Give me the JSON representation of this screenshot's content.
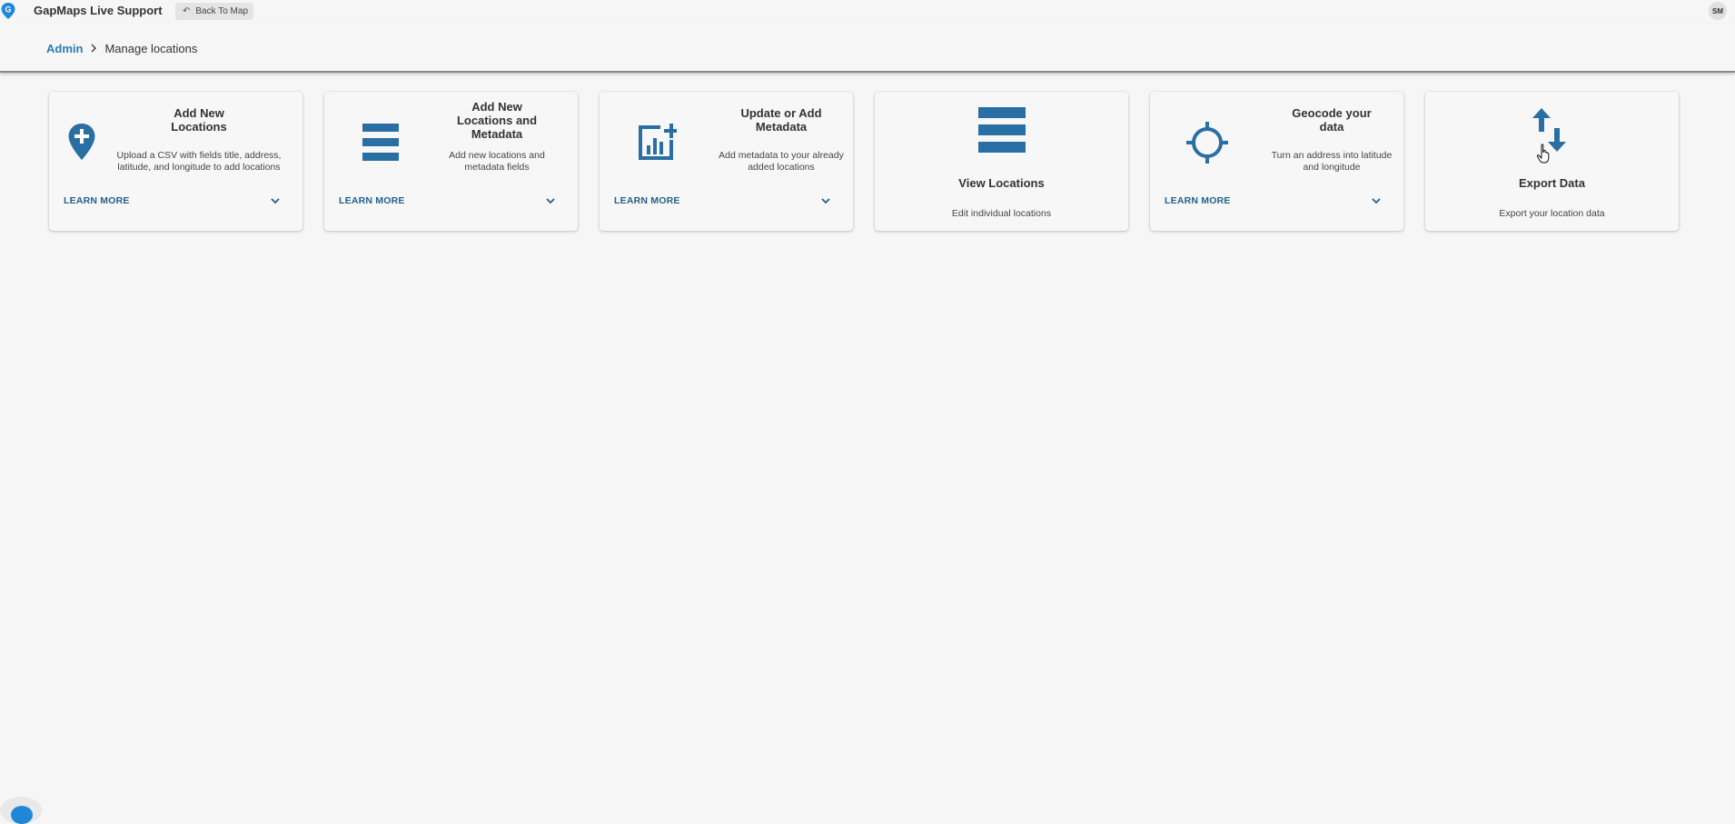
{
  "header": {
    "app_title": "GapMaps Live Support",
    "back_button_label": "Back To Map",
    "avatar_initials": "SM",
    "brand_color": "#1e88d6"
  },
  "breadcrumb": {
    "root": "Admin",
    "current": "Manage locations"
  },
  "accent_color": "#2a6fa3",
  "cards": [
    {
      "title": "Add New Locations",
      "title_lines": [
        "Add New",
        "Locations"
      ],
      "description_lines": [
        "Upload a CSV with fields title, address,",
        "latitude, and longitude to add locations"
      ],
      "icon": "location-plus-icon",
      "learn_more": "LEARN MORE"
    },
    {
      "title": "Add New Locations and Metadata",
      "title_lines": [
        "Add New",
        "Locations and",
        "Metadata"
      ],
      "description_lines": [
        "Add new locations and",
        "metadata fields"
      ],
      "icon": "list-bars-icon",
      "learn_more": "LEARN MORE"
    },
    {
      "title": "Update or Add Metadata",
      "title_lines": [
        "Update or Add",
        "Metadata"
      ],
      "description_lines": [
        "Add metadata to your already",
        "added locations"
      ],
      "icon": "chart-add-icon",
      "learn_more": "LEARN MORE"
    },
    {
      "title": "View Locations",
      "description": "Edit individual locations",
      "icon": "list-bars-icon"
    },
    {
      "title": "Geocode your data",
      "title_lines": [
        "Geocode your",
        "data"
      ],
      "description_lines": [
        "Turn an address into latitude",
        "and longitude"
      ],
      "icon": "crosshair-icon",
      "learn_more": "LEARN MORE"
    },
    {
      "title": "Export Data",
      "description": "Export your location data",
      "icon": "swap-vertical-icon"
    }
  ]
}
